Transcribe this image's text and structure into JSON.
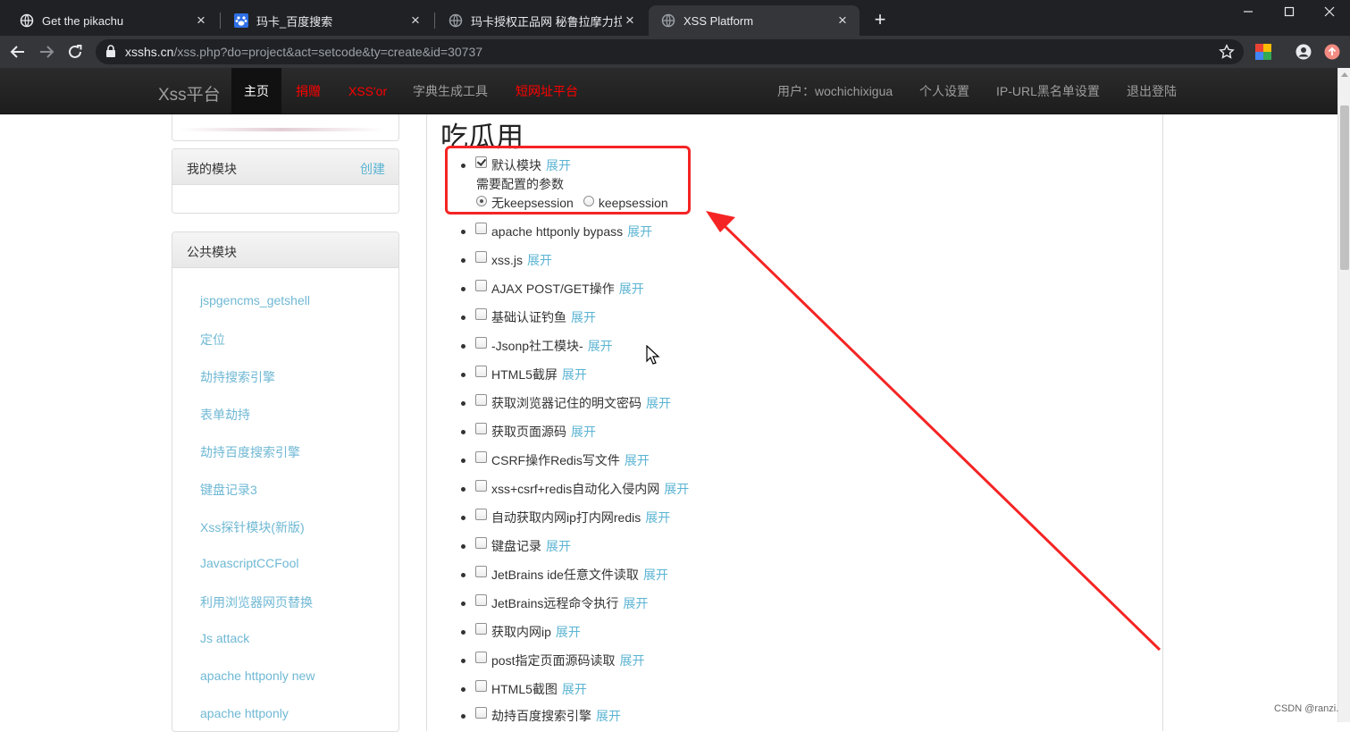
{
  "browser": {
    "tabs": [
      {
        "title": "Get the pikachu",
        "icon": "globe-icon",
        "active": false
      },
      {
        "title": "玛卡_百度搜索",
        "icon": "baidu-paw-icon",
        "active": false
      },
      {
        "title": "玛卡授权正品网 秘鲁拉摩力拉玛",
        "icon": "globe-icon",
        "active": false
      },
      {
        "title": "XSS Platform",
        "icon": "globe-icon",
        "active": true
      }
    ],
    "url_host": "xsshs.cn",
    "url_path": "/xss.php?do=project&act=setcode&ty=create&id=30737"
  },
  "nav": {
    "brand": "Xss平台",
    "items": [
      {
        "label": "主页",
        "style": "active"
      },
      {
        "label": "捐赠",
        "style": "red"
      },
      {
        "label": "XSS'or",
        "style": "red"
      },
      {
        "label": "字典生成工具",
        "style": "normal"
      },
      {
        "label": "短网址平台",
        "style": "red"
      }
    ],
    "user": "用户：wochichixigua",
    "right_links": [
      "个人设置",
      "IP-URL黑名单设置",
      "退出登陆"
    ]
  },
  "sidebar": {
    "my_modules_title": "我的模块",
    "my_modules_action": "创建",
    "public_modules_title": "公共模块",
    "public_modules": [
      "jspgencms_getshell",
      "定位",
      "劫持搜索引擎",
      "表单劫持",
      "劫持百度搜索引擎",
      "键盘记录3",
      "Xss探针模块(新版)",
      "JavascriptCCFool",
      "利用浏览器网页替换",
      "Js attack",
      "apache httponly new",
      "apache httponly"
    ]
  },
  "main": {
    "project_title": "吃瓜用",
    "expand_label": "展开",
    "default_module": {
      "name": "默认模块",
      "checked": true
    },
    "params_label": "需要配置的参数",
    "radio_options": [
      {
        "label": "无keepsession",
        "selected": true
      },
      {
        "label": "keepsession",
        "selected": false
      }
    ],
    "modules": [
      "apache httponly bypass",
      "xss.js",
      "AJAX POST/GET操作",
      "基础认证钓鱼",
      "-Jsonp社工模块-",
      "HTML5截屏",
      "获取浏览器记住的明文密码",
      "获取页面源码",
      "CSRF操作Redis写文件",
      "xss+csrf+redis自动化入侵内网",
      "自动获取内网ip打内网redis",
      "键盘记录",
      "JetBrains ide任意文件读取",
      "JetBrains远程命令执行",
      "获取内网ip",
      "post指定页面源码读取",
      "HTML5截图",
      "劫持百度搜索引擎"
    ]
  },
  "annotation": {
    "color": "#f52424"
  },
  "watermark": "CSDN @ranzi."
}
